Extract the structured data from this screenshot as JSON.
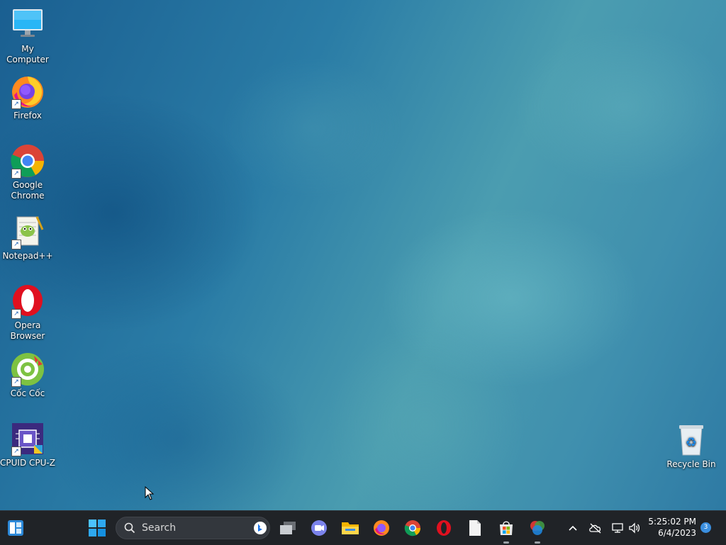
{
  "desktop": {
    "icons": [
      {
        "label": "My Computer",
        "icon": "monitor-icon"
      },
      {
        "label": "Firefox",
        "icon": "firefox-icon"
      },
      {
        "label": "Google Chrome",
        "icon": "chrome-icon"
      },
      {
        "label": "Notepad++",
        "icon": "notepad-plus-plus-icon"
      },
      {
        "label": "Opera Browser",
        "icon": "opera-icon"
      },
      {
        "label": "Cốc Cốc",
        "icon": "coc-coc-icon"
      },
      {
        "label": "CPUID CPU-Z",
        "icon": "cpu-z-icon"
      },
      {
        "label": "Recycle Bin",
        "icon": "recycle-bin-icon"
      }
    ]
  },
  "taskbar": {
    "search_placeholder": "Search",
    "apps": [
      "widgets",
      "start",
      "task-view",
      "teams",
      "file-explorer",
      "firefox",
      "chrome",
      "opera",
      "notepad",
      "microsoft-store",
      "color-app"
    ],
    "clock_time": "5:25:02 PM",
    "clock_date": "6/4/2023",
    "notification_count": "3"
  },
  "colors": {
    "taskbar_bg": "#202327",
    "accent": "#3a8fe0"
  }
}
